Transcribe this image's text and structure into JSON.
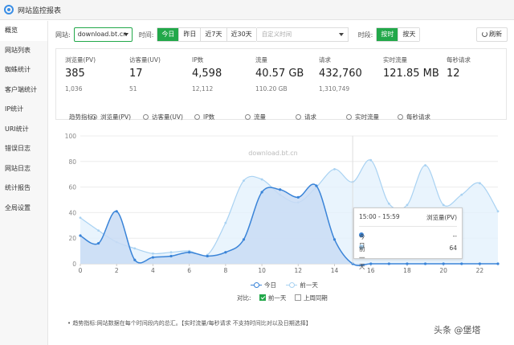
{
  "app": {
    "title": "网站监控报表",
    "icon": "monitor-icon"
  },
  "sidebar": {
    "items": [
      {
        "label": "概览",
        "active": true
      },
      {
        "label": "网站列表"
      },
      {
        "label": "蜘蛛统计"
      },
      {
        "label": "客户端统计"
      },
      {
        "label": "IP统计"
      },
      {
        "label": "URI统计"
      },
      {
        "label": "错误日志"
      },
      {
        "label": "网站日志"
      },
      {
        "label": "统计报告"
      },
      {
        "label": "全局设置"
      }
    ]
  },
  "filters": {
    "site_label": "网站:",
    "site_value": "download.bt.cn",
    "time_label": "时间:",
    "time_buttons": [
      "今日",
      "昨日",
      "近7天",
      "近30天"
    ],
    "time_active": "今日",
    "date_placeholder": "自定义时间",
    "period_label": "时段:",
    "period_buttons": [
      "按时",
      "按天"
    ],
    "period_active": "按时",
    "refresh_label": "刷新"
  },
  "stats": [
    {
      "label": "浏览量(PV)",
      "value": "385",
      "sub": "1,036"
    },
    {
      "label": "访客量(UV)",
      "value": "17",
      "sub": "51"
    },
    {
      "label": "IP数",
      "value": "4,598",
      "sub": "12,112"
    },
    {
      "label": "流量",
      "value": "40.57 GB",
      "sub": "110.20 GB"
    },
    {
      "label": "请求",
      "value": "432,760",
      "sub": "1,310,749"
    },
    {
      "label": "实时流量",
      "value": "121.85 MB",
      "sub": ""
    },
    {
      "label": "每秒请求",
      "value": "12",
      "sub": ""
    }
  ],
  "trend": {
    "label": "趋势指标:",
    "options": [
      "浏览量(PV)",
      "访客量(UV)",
      "IP数",
      "流量",
      "请求",
      "实时流量",
      "每秒请求"
    ],
    "selected": "浏览量(PV)"
  },
  "chart_data": {
    "type": "line",
    "watermark": "download.bt.cn",
    "x": [
      0,
      1,
      2,
      3,
      4,
      5,
      6,
      7,
      8,
      9,
      10,
      11,
      12,
      13,
      14,
      15,
      16,
      17,
      18,
      19,
      20,
      21,
      22,
      23
    ],
    "xticks": [
      0,
      2,
      4,
      6,
      8,
      10,
      12,
      14,
      16,
      18,
      20,
      22
    ],
    "ylim": [
      0,
      100
    ],
    "yticks": [
      0,
      20,
      40,
      60,
      80,
      100
    ],
    "grid": true,
    "legend_position": "bottom",
    "series": [
      {
        "name": "今日",
        "color": "#3a84d8",
        "fill": "#c9dcf5",
        "values": [
          22,
          16,
          41,
          3,
          5,
          6,
          9,
          6,
          9,
          19,
          56,
          58,
          52,
          61,
          19,
          0,
          0,
          0,
          0,
          0,
          0,
          0,
          0,
          0
        ]
      },
      {
        "name": "前一天",
        "color": "#a9d2f2",
        "fill": "#e3f1fc",
        "values": [
          36,
          26,
          17,
          12,
          8,
          9,
          10,
          7,
          32,
          65,
          66,
          54,
          48,
          60,
          74,
          64,
          81,
          47,
          46,
          77,
          46,
          54,
          63,
          41
        ]
      }
    ]
  },
  "tooltip": {
    "time": "15:00 - 15:59",
    "metric": "浏览量(PV)",
    "rows": [
      {
        "name": "今日",
        "value": "--"
      },
      {
        "name": "前一天",
        "value": "64"
      }
    ]
  },
  "compare": {
    "label": "对比:",
    "prev_day": "前一天",
    "prev_day_checked": true,
    "prev_period": "上周同期",
    "prev_period_checked": false
  },
  "note": "趋势指标:网站数据在每个时间段内的总汇。【实时流量/每秒请求 不支持时间比对以及日期选择】",
  "watermark_corner": "头条 @堡塔"
}
